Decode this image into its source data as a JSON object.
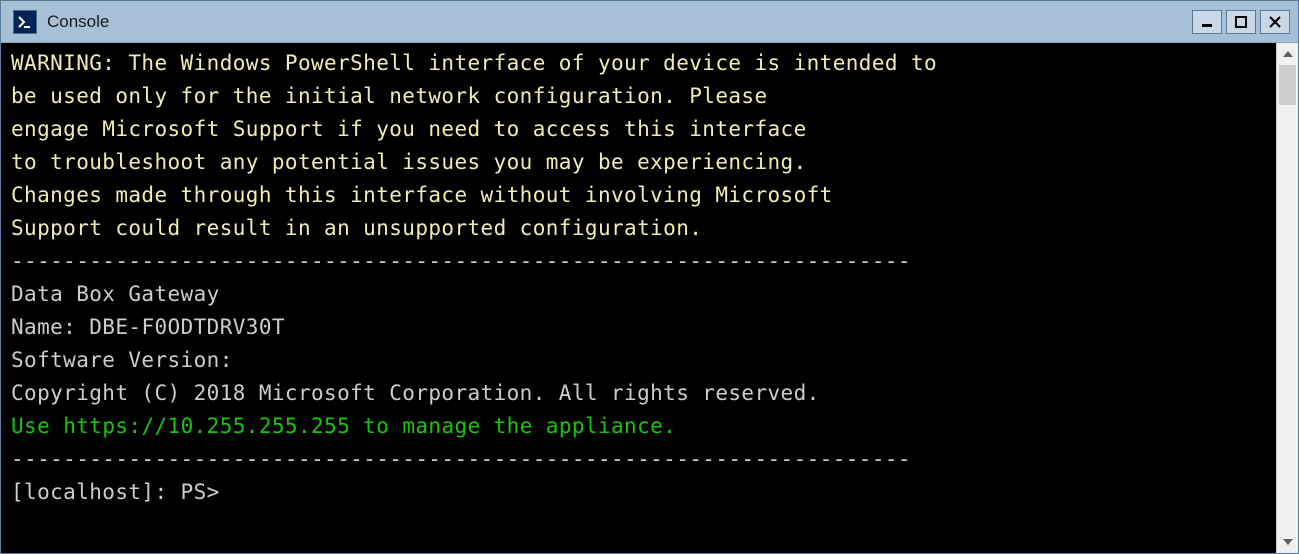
{
  "window": {
    "title": "Console"
  },
  "console": {
    "warning_line1": "WARNING: The Windows PowerShell interface of your device is intended to",
    "warning_line2": "be used only for the initial network configuration. Please",
    "warning_line3": "engage Microsoft Support if you need to access this interface",
    "warning_line4": "to troubleshoot any potential issues you may be experiencing.",
    "warning_line5": "Changes made through this interface without involving Microsoft",
    "warning_line6": "Support could result in an unsupported configuration.",
    "divider1": "---------------------------------------------------------------------",
    "product": "Data Box Gateway",
    "name_label": "Name: ",
    "name_value": "DBE-F0ODTDRV30T",
    "software_version_label": "Software Version:",
    "copyright": "Copyright (C) 2018 Microsoft Corporation. All rights reserved.",
    "manage_prefix": "Use ",
    "manage_url": "https://10.255.255.255",
    "manage_suffix": " to manage the appliance.",
    "divider2": "---------------------------------------------------------------------",
    "prompt": "[localhost]: PS>"
  }
}
